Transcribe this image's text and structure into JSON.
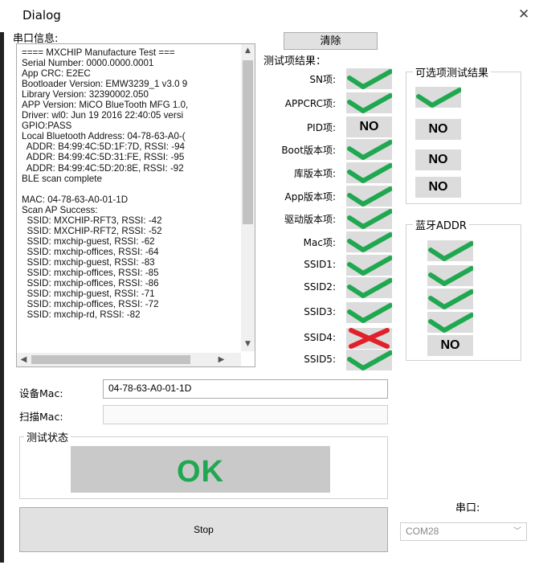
{
  "window": {
    "title": "Dialog",
    "close_glyph": "✕"
  },
  "serial": {
    "label": "串口信息:",
    "log": "==== MXCHIP Manufacture Test ===\nSerial Number: 0000.0000.0001\nApp CRC: E2EC\nBootloader Version: EMW3239_1 v3.0 9\nLibrary Version: 32390002.050\nAPP Version: MiCO BlueTooth MFG 1.0,\nDriver: wl0: Jun 19 2016 22:40:05 versi\nGPIO:PASS\nLocal Bluetooth Address: 04-78-63-A0-(\n  ADDR: B4:99:4C:5D:1F:7D, RSSI: -94\n  ADDR: B4:99:4C:5D:31:FE, RSSI: -95\n  ADDR: B4:99:4C:5D:20:8E, RSSI: -92\nBLE scan complete\n\nMAC: 04-78-63-A0-01-1D\nScan AP Success:\n  SSID: MXCHIP-RFT3, RSSI: -42\n  SSID: MXCHIP-RFT2, RSSI: -52\n  SSID: mxchip-guest, RSSI: -62\n  SSID: mxchip-offices, RSSI: -64\n  SSID: mxchip-guest, RSSI: -83\n  SSID: mxchip-offices, RSSI: -85\n  SSID: mxchip-offices, RSSI: -86\n  SSID: mxchip-guest, RSSI: -71\n  SSID: mxchip-offices, RSSI: -72\n  SSID: mxchip-rd, RSSI: -82"
  },
  "clear_button": "清除",
  "results": {
    "title": "测试项结果：",
    "items": [
      {
        "label": "SN项:",
        "status": "pass"
      },
      {
        "label": "APPCRC项:",
        "status": "pass"
      },
      {
        "label": "PID项:",
        "status": "no",
        "text": "NO"
      },
      {
        "label": "Boot版本项:",
        "status": "pass"
      },
      {
        "label": "库版本项:",
        "status": "pass"
      },
      {
        "label": "App版本项:",
        "status": "pass"
      },
      {
        "label": "驱动版本项:",
        "status": "pass"
      },
      {
        "label": "Mac项:",
        "status": "pass"
      },
      {
        "label": "SSID1:",
        "status": "pass"
      },
      {
        "label": "SSID2:",
        "status": "pass"
      },
      {
        "label": "SSID3:",
        "status": "pass"
      },
      {
        "label": "SSID4:",
        "status": "fail"
      },
      {
        "label": "SSID5:",
        "status": "pass"
      }
    ]
  },
  "optional": {
    "title": "可选项测试结果",
    "items": [
      {
        "status": "pass"
      },
      {
        "status": "no",
        "text": "NO"
      },
      {
        "status": "no",
        "text": "NO"
      },
      {
        "status": "no",
        "text": "NO"
      }
    ]
  },
  "bt_addr": {
    "title": "蓝牙ADDR",
    "items": [
      {
        "status": "pass"
      },
      {
        "status": "pass"
      },
      {
        "status": "pass"
      },
      {
        "status": "pass"
      },
      {
        "status": "no",
        "text": "NO"
      }
    ]
  },
  "device_mac": {
    "label": "设备Mac:",
    "value": "04-78-63-A0-01-1D"
  },
  "scan_mac": {
    "label": "扫描Mac:",
    "value": ""
  },
  "test_status": {
    "label": "测试状态",
    "value": "OK"
  },
  "stop_button": "Stop",
  "port": {
    "label": "串口:",
    "selected": "COM28"
  },
  "colors": {
    "pass": "#1fa850",
    "fail": "#e0202a",
    "indicator_bg": "#dcdcdc",
    "ok_text": "#1fa850"
  }
}
